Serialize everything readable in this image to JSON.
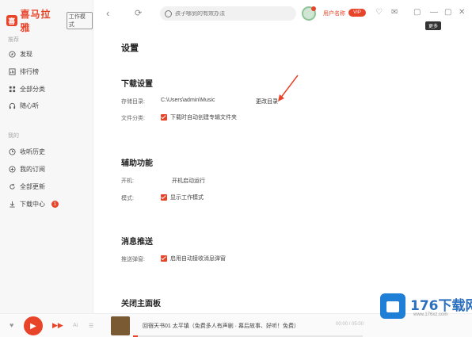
{
  "app": {
    "name": "喜马拉雅",
    "badge": "工作模式"
  },
  "sidebar": {
    "section_recommend": "推荐",
    "items_top": [
      {
        "label": "发现",
        "icon": "compass-icon"
      },
      {
        "label": "排行榜",
        "icon": "chart-icon"
      },
      {
        "label": "全部分类",
        "icon": "grid-icon"
      },
      {
        "label": "随心听",
        "icon": "headphone-icon"
      }
    ],
    "section_mine": "我的",
    "items_mine": [
      {
        "label": "收听历史",
        "icon": "clock-icon"
      },
      {
        "label": "我的订阅",
        "icon": "subscribe-icon"
      },
      {
        "label": "全部更新",
        "icon": "refresh-icon"
      },
      {
        "label": "下载中心",
        "icon": "download-icon",
        "badge": "1"
      }
    ]
  },
  "topbar": {
    "search_placeholder": "孩子哪到的有效办法",
    "username": "用户名称",
    "vip": "VIP",
    "tooltip": "更多"
  },
  "settings": {
    "title": "设置",
    "download": {
      "title": "下载设置",
      "path_label": "存储目录:",
      "path_value": "C:\\Users\\admin\\Music",
      "change_link": "更改目录",
      "category_label": "文件分类:",
      "category_option": "下载时自动创建专辑文件夹"
    },
    "assist": {
      "title": "辅助功能",
      "startup_label": "开机:",
      "startup_option": "开机启动运行",
      "mode_label": "模式:",
      "mode_option": "显示工作模式"
    },
    "push": {
      "title": "消息推送",
      "push_label": "推送弹窗:",
      "push_option": "启用自动接收消息弹窗"
    },
    "close": {
      "title": "关闭主面板"
    }
  },
  "player": {
    "track_title": "回宿天书01 太平镇（免费多人有声剧 · 幕后故事、好听！免费）",
    "time": "00:00 / 05:00",
    "progress": 0.02,
    "volume_label": "Ai"
  },
  "watermark": {
    "text": "176下载网",
    "sub": "www.176xz.com"
  },
  "colors": {
    "accent": "#e8442a",
    "watermark_blue": "#1f7ed6"
  }
}
